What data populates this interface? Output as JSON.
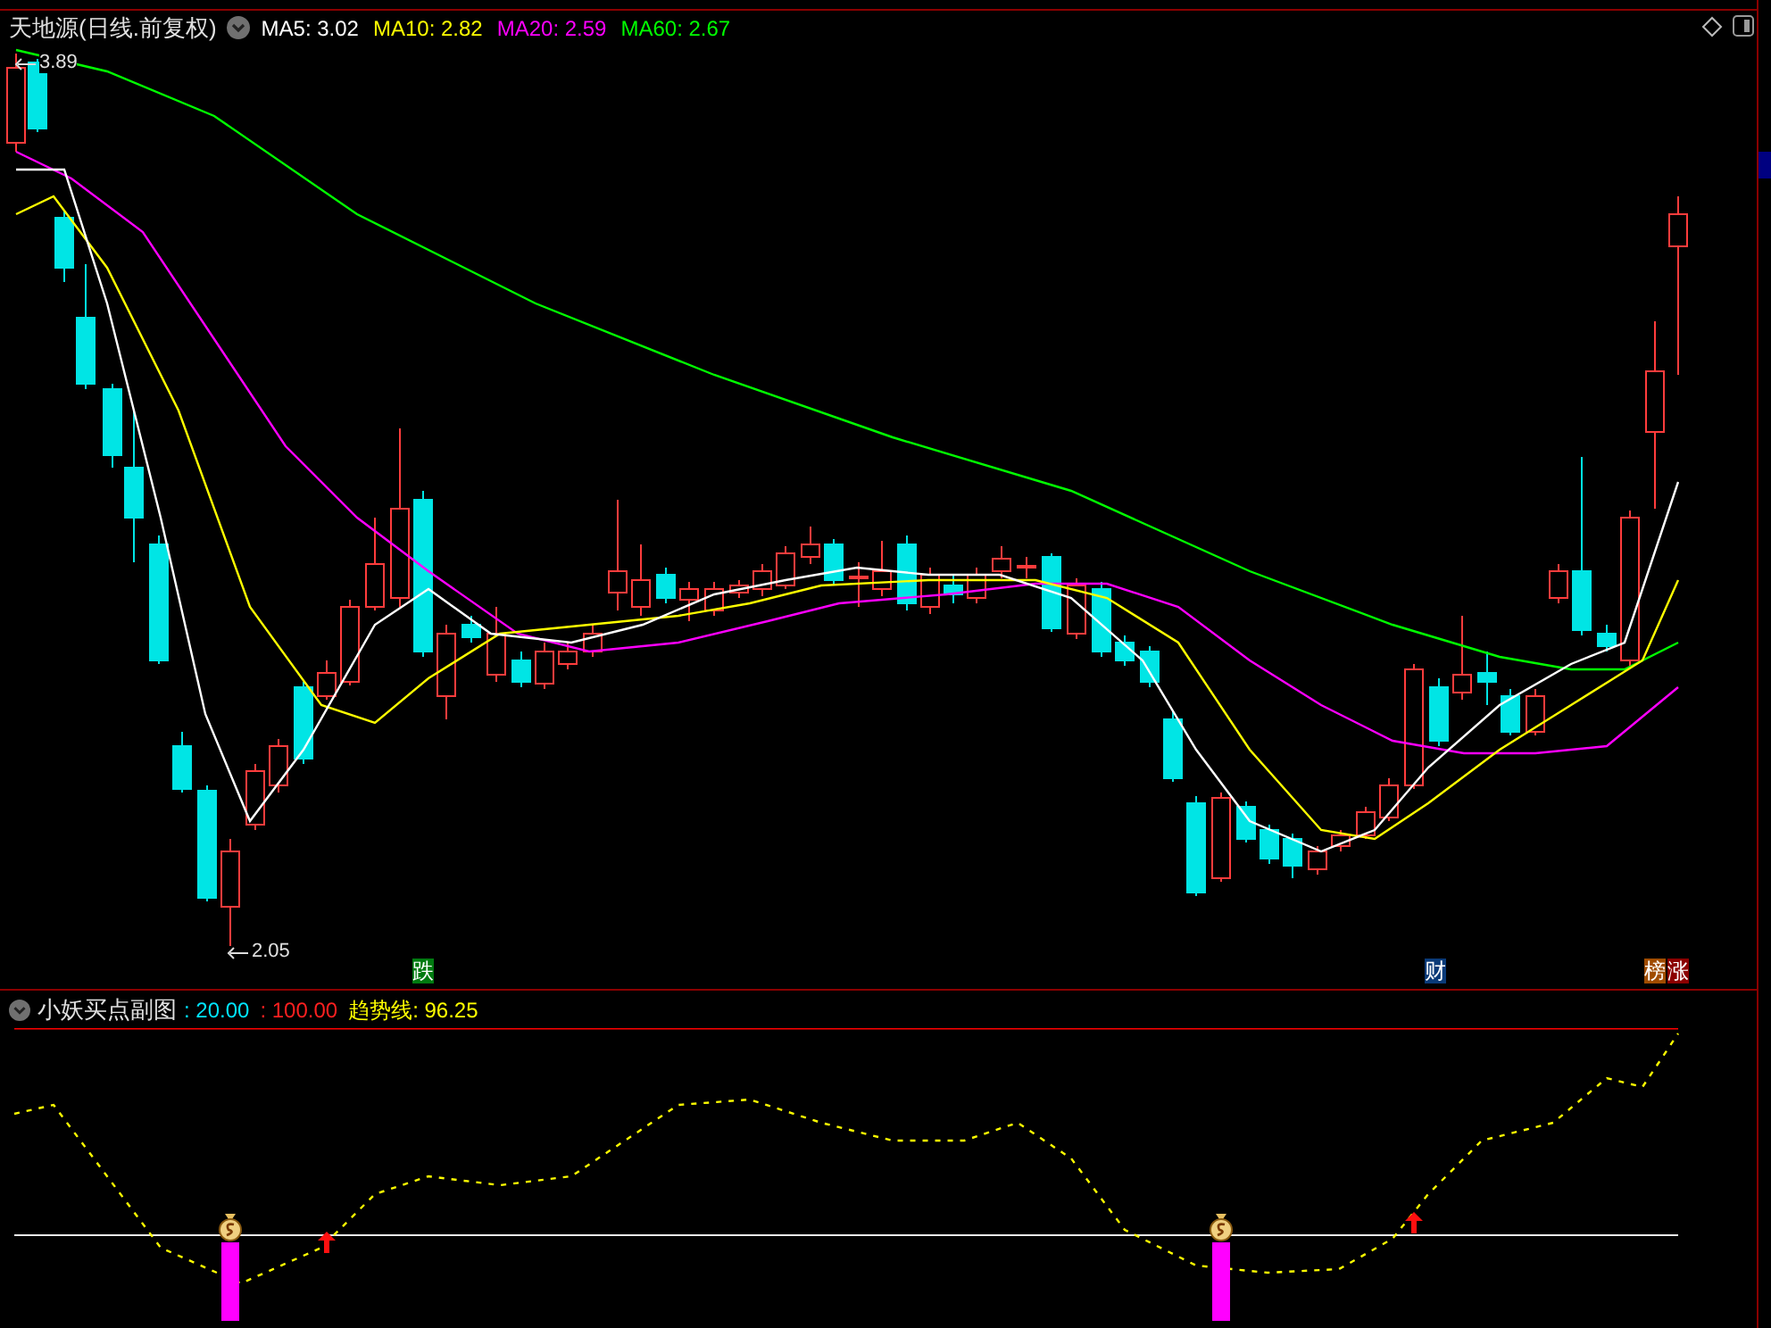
{
  "chart": {
    "title": "天地源(日线.前复权)",
    "indicators": [
      {
        "label": "MA5: 3.02",
        "color": "#ffffff"
      },
      {
        "label": "MA10: 2.82",
        "color": "#ffff00"
      },
      {
        "label": "MA20: 2.59",
        "color": "#ff00ff"
      },
      {
        "label": "MA60: 2.67",
        "color": "#00ff00"
      }
    ],
    "price_labels": [
      {
        "text": "3.89"
      },
      {
        "text": "2.05"
      }
    ],
    "markers": [
      {
        "text": "跌",
        "color": "#007a10"
      },
      {
        "text": "财",
        "color": "#0a3a78"
      },
      {
        "text": "榜",
        "color": "#a04c00"
      },
      {
        "text": "涨",
        "color": "#8b0000"
      }
    ]
  },
  "subchart": {
    "title": "小妖买点副图",
    "values": [
      {
        "text": ": 20.00",
        "color": "#00e5ff"
      },
      {
        "text": ": 100.00",
        "color": "#ff2020"
      },
      {
        "text": "趋势线: 96.25",
        "color": "#ffff00"
      }
    ]
  }
}
